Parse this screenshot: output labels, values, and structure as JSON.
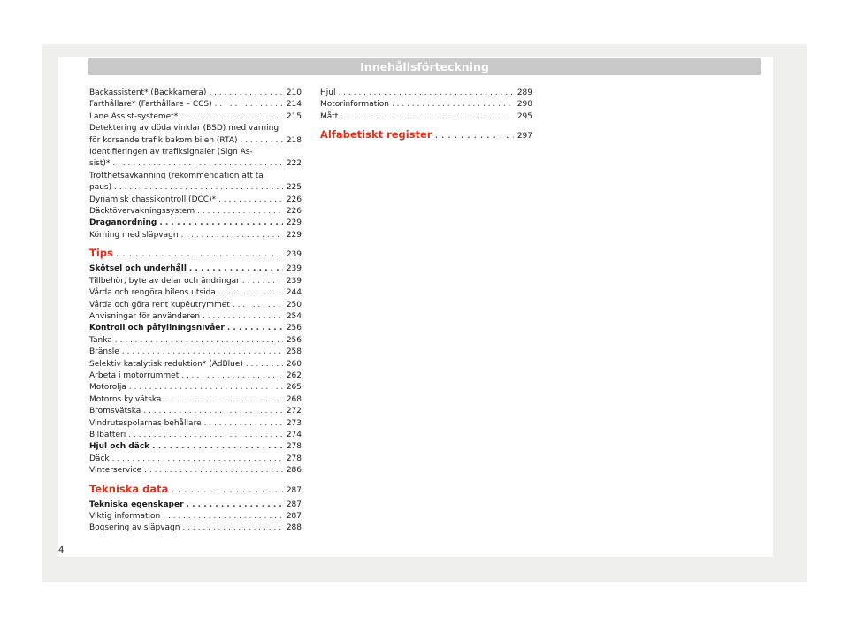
{
  "header": {
    "title": "Innehållsförteckning"
  },
  "left_column": [
    {
      "lines": [
        "Backassistent* (Backkamera)"
      ],
      "page": "210",
      "type": "entry"
    },
    {
      "lines": [
        "Farthållare* (Farthållare – CCS)"
      ],
      "page": "214",
      "type": "entry"
    },
    {
      "lines": [
        "Lane Assist-systemet*"
      ],
      "page": "215",
      "type": "entry"
    },
    {
      "lines": [
        "Detektering av döda vinklar (BSD) med varning",
        "för korsande trafik bakom bilen (RTA)"
      ],
      "page": "218",
      "type": "entry"
    },
    {
      "lines": [
        "Identifieringen av trafiksignaler (Sign As-",
        "sist)*"
      ],
      "page": "222",
      "type": "entry"
    },
    {
      "lines": [
        "Trötthetsavkänning (rekommendation att ta",
        "paus)"
      ],
      "page": "225",
      "type": "entry"
    },
    {
      "lines": [
        "Dynamisk chassikontroll (DCC)*"
      ],
      "page": "226",
      "type": "entry"
    },
    {
      "lines": [
        "Däcktövervakningssystem"
      ],
      "page": "226",
      "type": "entry"
    },
    {
      "lines": [
        "Draganordning"
      ],
      "page": "229",
      "type": "sub"
    },
    {
      "lines": [
        "Körning med släpvagn"
      ],
      "page": "229",
      "type": "entry"
    },
    {
      "lines": [
        "Tips"
      ],
      "page": "239",
      "type": "section"
    },
    {
      "lines": [
        "Skötsel och underhåll"
      ],
      "page": "239",
      "type": "sub"
    },
    {
      "lines": [
        "Tillbehör, byte av delar och ändringar"
      ],
      "page": "239",
      "type": "entry"
    },
    {
      "lines": [
        "Vårda och rengöra bilens utsida"
      ],
      "page": "244",
      "type": "entry"
    },
    {
      "lines": [
        "Vårda och göra rent kupéutrymmet"
      ],
      "page": "250",
      "type": "entry"
    },
    {
      "lines": [
        "Anvisningar för användaren"
      ],
      "page": "254",
      "type": "entry"
    },
    {
      "lines": [
        "Kontroll och påfyllningsnivåer"
      ],
      "page": "256",
      "type": "sub"
    },
    {
      "lines": [
        "Tanka"
      ],
      "page": "256",
      "type": "entry"
    },
    {
      "lines": [
        "Bränsle"
      ],
      "page": "258",
      "type": "entry"
    },
    {
      "lines": [
        "Selektiv katalytisk reduktion* (AdBlue)"
      ],
      "page": "260",
      "type": "entry"
    },
    {
      "lines": [
        "Arbeta i motorrummet"
      ],
      "page": "262",
      "type": "entry"
    },
    {
      "lines": [
        "Motorolja"
      ],
      "page": "265",
      "type": "entry"
    },
    {
      "lines": [
        "Motorns kylvätska"
      ],
      "page": "268",
      "type": "entry"
    },
    {
      "lines": [
        "Bromsvätska"
      ],
      "page": "272",
      "type": "entry"
    },
    {
      "lines": [
        "Vindrutespolarnas behållare"
      ],
      "page": "273",
      "type": "entry"
    },
    {
      "lines": [
        "Bilbatteri"
      ],
      "page": "274",
      "type": "entry"
    },
    {
      "lines": [
        "Hjul och däck"
      ],
      "page": "278",
      "type": "sub"
    },
    {
      "lines": [
        "Däck"
      ],
      "page": "278",
      "type": "entry"
    },
    {
      "lines": [
        "Vinterservice"
      ],
      "page": "286",
      "type": "entry"
    },
    {
      "lines": [
        "Tekniska data"
      ],
      "page": "287",
      "type": "section"
    },
    {
      "lines": [
        "Tekniska egenskaper"
      ],
      "page": "287",
      "type": "sub"
    },
    {
      "lines": [
        "Viktig information"
      ],
      "page": "287",
      "type": "entry"
    },
    {
      "lines": [
        "Bogsering av släpvagn"
      ],
      "page": "288",
      "type": "entry"
    }
  ],
  "right_column": [
    {
      "lines": [
        "Hjul"
      ],
      "page": "289",
      "type": "entry"
    },
    {
      "lines": [
        "Motorinformation"
      ],
      "page": "290",
      "type": "entry"
    },
    {
      "lines": [
        "Mått"
      ],
      "page": "295",
      "type": "entry"
    },
    {
      "lines": [
        "Alfabetiskt register"
      ],
      "page": "297",
      "type": "section"
    }
  ],
  "footer": {
    "page_number": "4"
  },
  "colors": {
    "accent": "#e0311d",
    "header_bar": "#c9c9c9",
    "page_bg": "#f0f0ee"
  }
}
